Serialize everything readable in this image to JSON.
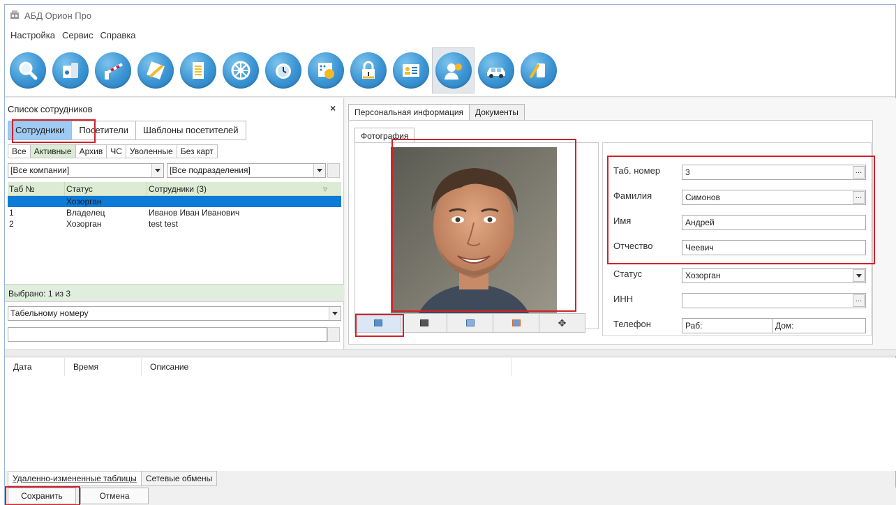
{
  "window": {
    "title": "АБД Орион Про"
  },
  "menu": [
    "Настройка",
    "Сервис",
    "Справка"
  ],
  "toolbar_icons": [
    "search-icon",
    "terminal-icon",
    "barrier-icon",
    "building-plan-icon",
    "document-icon",
    "wheel-icon",
    "alarm-clock-icon",
    "schedule-icon",
    "lock-icon",
    "id-card-icon",
    "employee-icon",
    "car-icon",
    "key-icon"
  ],
  "left": {
    "title": "Список сотрудников",
    "close": "×",
    "tabs": [
      "Сотрудники",
      "Посетители",
      "Шаблоны посетителей"
    ],
    "subtabs": [
      "Все",
      "Активные",
      "Архив",
      "ЧС",
      "Уволенные",
      "Без карт"
    ],
    "company_combo": "[Все компании]",
    "division_combo": "[Все подразделения]",
    "columns": [
      "Таб №",
      "Статус",
      "Сотрудники (3)"
    ],
    "rows": [
      {
        "tab": "",
        "status": "Хозорган",
        "name": ""
      },
      {
        "tab": "1",
        "status": "Владелец",
        "name": "Иванов Иван Иванович"
      },
      {
        "tab": "2",
        "status": "Хозорган",
        "name": "test test"
      }
    ],
    "selected_info": "Выбрано: 1 из 3",
    "search_by": "Табельному номеру",
    "search_value": ""
  },
  "right": {
    "tabs": [
      "Персональная информация",
      "Документы"
    ],
    "photo_tab": "Фотография",
    "fields": {
      "tab_label": "Таб. номер",
      "tab_value": "3",
      "last_label": "Фамилия",
      "last_value": "Симонов",
      "first_label": "Имя",
      "first_value": "Андрей",
      "middle_label": "Отчество",
      "middle_value": "Чеевич",
      "status_label": "Статус",
      "status_value": "Хозорган",
      "inn_label": "ИНН",
      "inn_value": "",
      "phone_label": "Телефон",
      "phone_work": "Раб:",
      "phone_home": "Дом:"
    }
  },
  "log": {
    "columns": [
      "Дата",
      "Время",
      "Описание"
    ]
  },
  "bottom_tabs": [
    "Удаленно-измененные таблицы",
    "Сетевые обмены"
  ],
  "buttons": {
    "save": "Сохранить",
    "cancel": "Отмена"
  }
}
